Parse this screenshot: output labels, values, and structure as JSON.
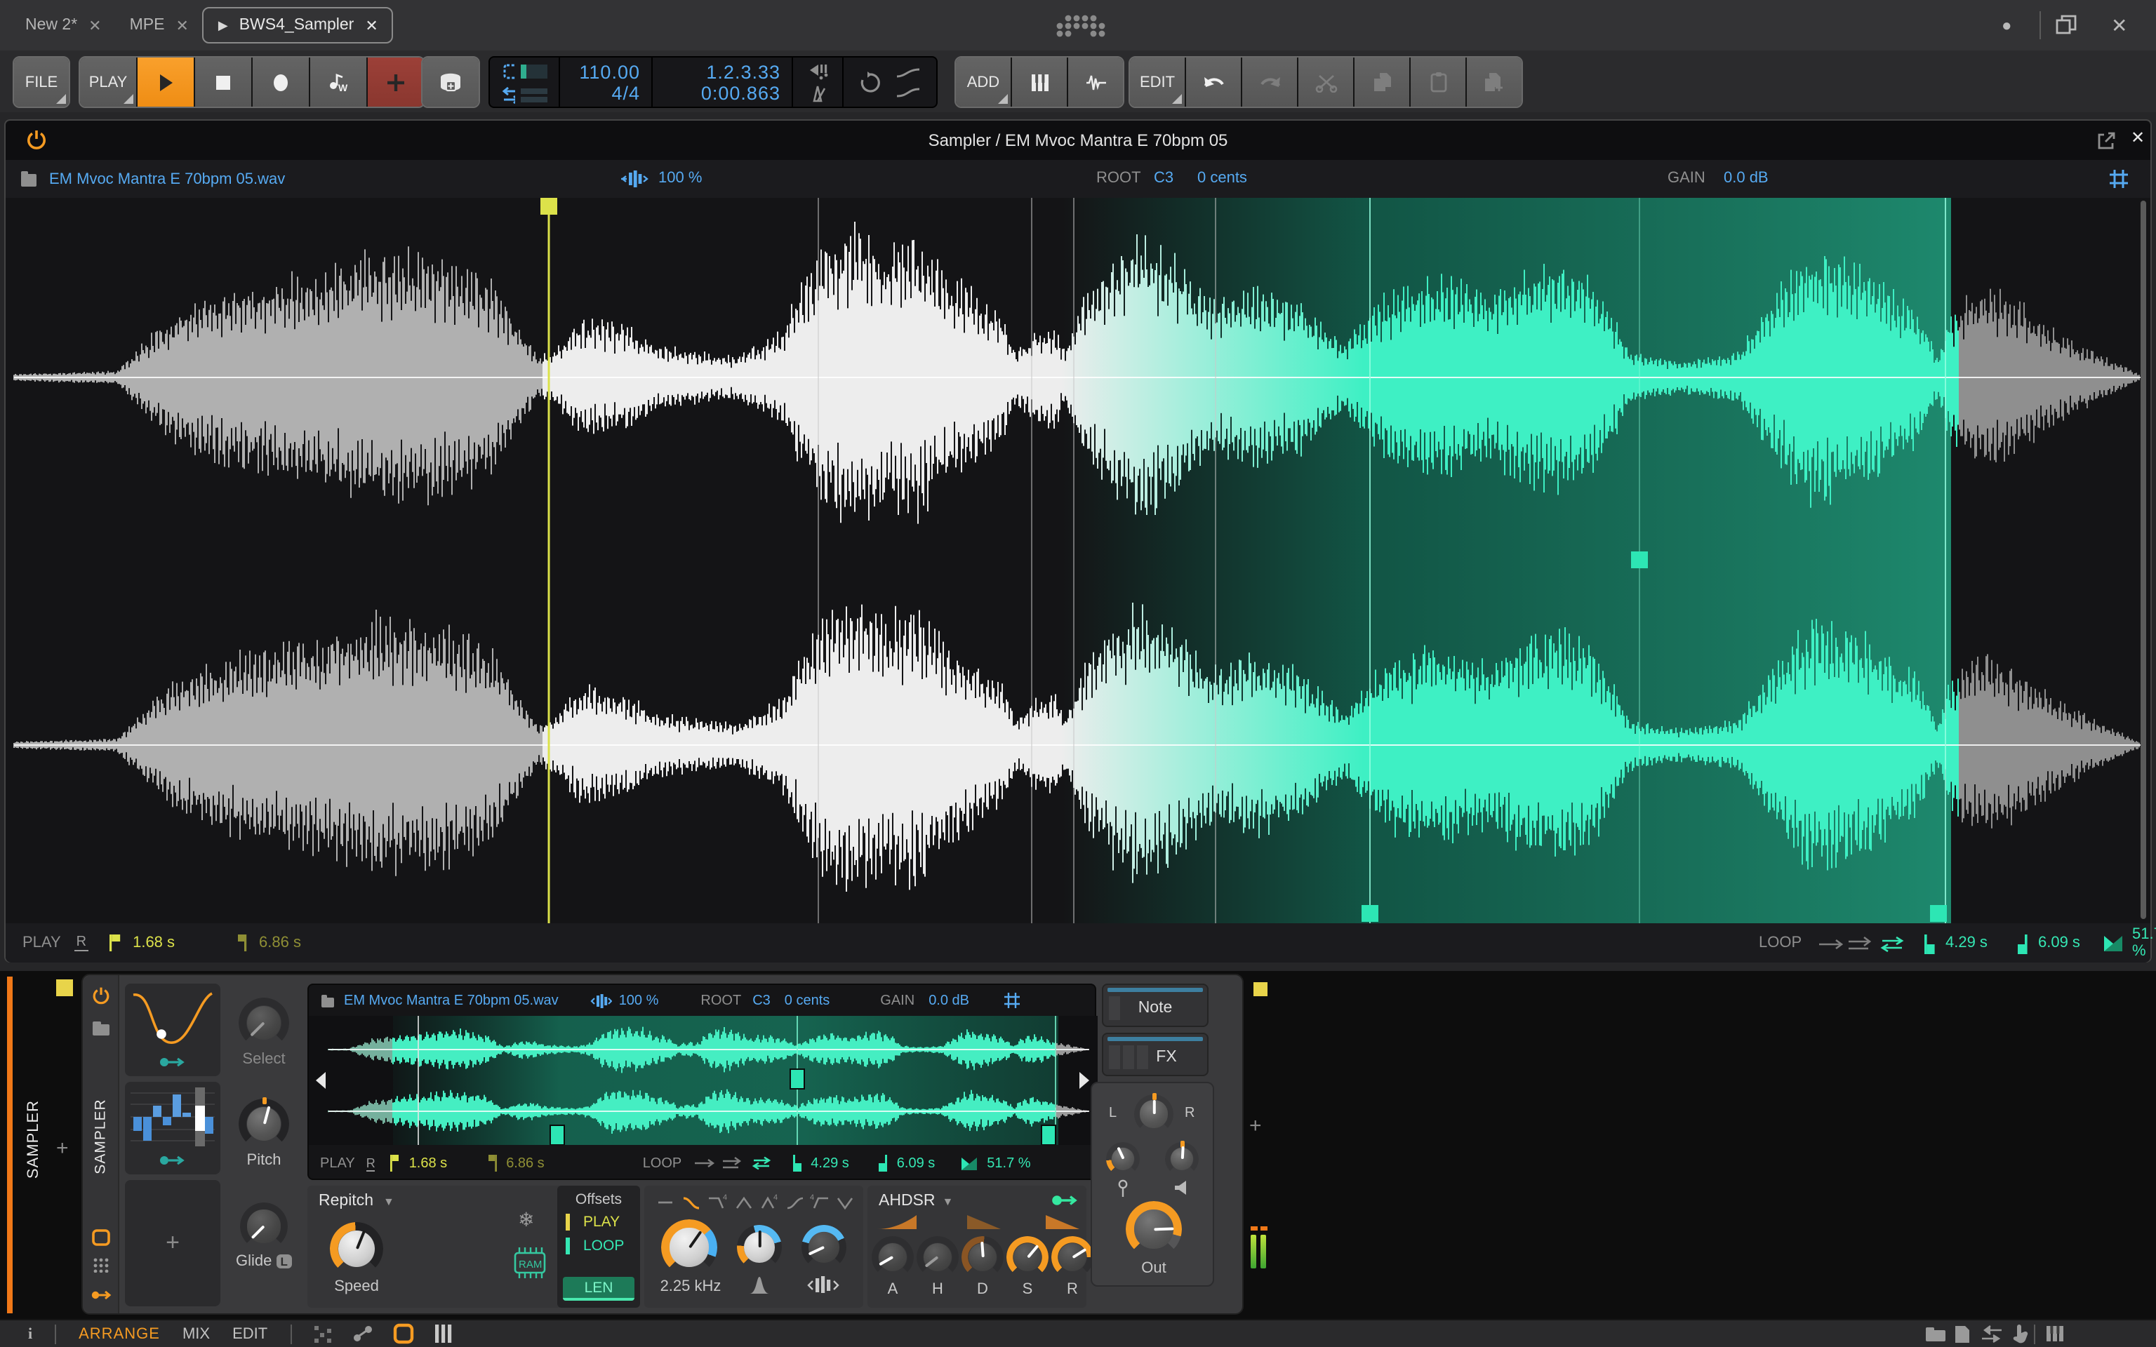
{
  "window": {
    "tabs": [
      {
        "label": "New 2*"
      },
      {
        "label": "MPE"
      },
      {
        "label": "BWS4_Sampler"
      }
    ],
    "close_glyph": "✕",
    "play_glyph": "▶",
    "minimize_glyph": "●"
  },
  "transport": {
    "file": "FILE",
    "play": "PLAY",
    "add": "ADD",
    "edit": "EDIT",
    "tempo": "110.00",
    "time_signature": "4/4",
    "position": "1.2.3.33",
    "time": "0:00.863"
  },
  "editor": {
    "title": "Sampler / EM Mvoc Mantra E 70bpm 05",
    "file_name": "EM Mvoc Mantra E 70bpm 05.wav",
    "stretch": "100 %",
    "root_label": "ROOT",
    "root_note": "C3",
    "root_cents": "0 cents",
    "gain_label": "GAIN",
    "gain_value": "0.0 dB",
    "play_label": "PLAY",
    "reverse_label": "R",
    "play_start": "1.68 s",
    "play_end": "6.86 s",
    "loop_label": "LOOP",
    "loop_start": "4.29 s",
    "loop_end": "6.09 s",
    "loop_crossfade": "51.7 %"
  },
  "device": {
    "track_name": "SAMPLER",
    "device_name": "SAMPLER",
    "add_track_glyph": "+",
    "select_label": "Select",
    "pitch_label": "Pitch",
    "glide_label": "Glide",
    "glide_badge": "L",
    "mode": "Repitch",
    "speed_label": "Speed",
    "ram_label": "RAM",
    "offsets": {
      "title": "Offsets",
      "play": "PLAY",
      "loop": "LOOP",
      "len": "LEN"
    },
    "filter_freq": "2.25 kHz",
    "envelope": {
      "name": "AHDSR",
      "attack": "A",
      "hold": "H",
      "decay": "D",
      "sustain": "S",
      "release": "R"
    },
    "out_label": "Out",
    "pan_left": "L",
    "pan_right": "R",
    "note_label": "Note",
    "fx_label": "FX"
  },
  "statusbar": {
    "info_glyph": "i",
    "arrange": "ARRANGE",
    "mix": "MIX",
    "edit": "EDIT"
  },
  "colors": {
    "accent_orange": "#f59b22",
    "accent_blue": "#56aaf2",
    "accent_teal": "#3ceec2",
    "accent_yellow": "#dce24a",
    "record_red": "#9c4038"
  }
}
